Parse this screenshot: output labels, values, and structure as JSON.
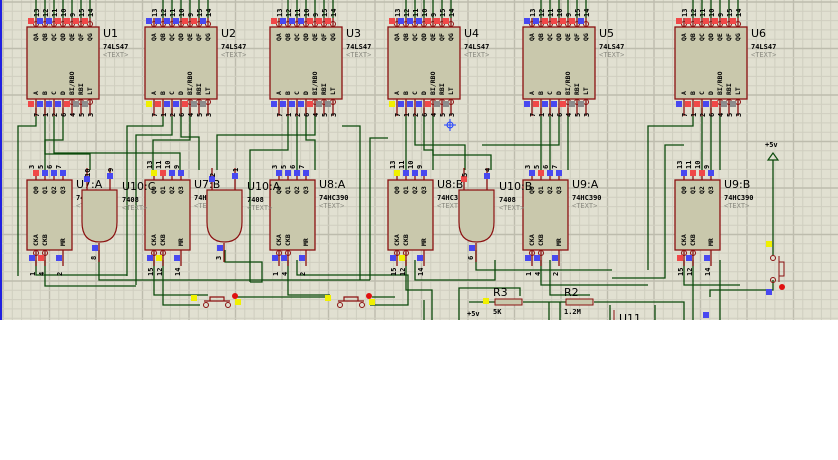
{
  "schematic": {
    "decoders": [
      {
        "ref": "U1",
        "part": "74LS47",
        "text": "<TEXT>",
        "top_states": [
          "r",
          "b",
          "b",
          "r",
          "r",
          "r",
          "r"
        ],
        "bottom_states": [
          "r",
          "b",
          "b",
          "b",
          "r",
          "g",
          "g"
        ]
      },
      {
        "ref": "U2",
        "part": "74LS47",
        "text": "<TEXT>",
        "top_states": [
          "b",
          "b",
          "b",
          "b",
          "r",
          "r",
          "b"
        ],
        "bottom_states": [
          "y",
          "r",
          "b",
          "b",
          "r",
          "g",
          "g"
        ]
      },
      {
        "ref": "U3",
        "part": "74LS47",
        "text": "<TEXT>",
        "top_states": [
          "r",
          "b",
          "b",
          "b",
          "r",
          "r",
          "r"
        ],
        "bottom_states": [
          "b",
          "b",
          "b",
          "b",
          "r",
          "g",
          "g"
        ]
      },
      {
        "ref": "U4",
        "part": "74LS47",
        "text": "<TEXT>",
        "top_states": [
          "r",
          "b",
          "b",
          "b",
          "r",
          "r",
          "r"
        ],
        "bottom_states": [
          "y",
          "b",
          "b",
          "b",
          "r",
          "g",
          "g"
        ]
      },
      {
        "ref": "U5",
        "part": "74LS47",
        "text": "<TEXT>",
        "top_states": [
          "b",
          "b",
          "r",
          "r",
          "r",
          "r",
          "b"
        ],
        "bottom_states": [
          "b",
          "r",
          "b",
          "b",
          "r",
          "g",
          "g"
        ]
      },
      {
        "ref": "U6",
        "part": "74LS47",
        "text": "<TEXT>",
        "top_states": [
          "r",
          "r",
          "r",
          "r",
          "r",
          "r",
          "r"
        ],
        "bottom_states": [
          "b",
          "r",
          "r",
          "b",
          "r",
          "g",
          "g"
        ]
      }
    ],
    "decoder_pins": {
      "top_numbers": [
        "13",
        "12",
        "11",
        "10",
        "9",
        "15",
        "14"
      ],
      "top_names": [
        "QA",
        "QB",
        "QC",
        "QD",
        "QE",
        "QF",
        "QG"
      ],
      "bottom_numbers": [
        "7",
        "1",
        "2",
        "6",
        "4",
        "5",
        "3"
      ],
      "bottom_names": [
        "A",
        "B",
        "C",
        "D",
        "BI/RBO",
        "RBI",
        "LT"
      ]
    },
    "counters": [
      {
        "ref": "U7:A",
        "part": "74HC390",
        "text": "<TEXT>",
        "top_numbers": [
          "3",
          "5",
          "6",
          "7"
        ],
        "bottom_numbers": [
          "1",
          "4",
          "2"
        ],
        "top_states": [
          "r",
          "b",
          "b",
          "b"
        ],
        "bottom_states": [
          "b",
          "r",
          "b"
        ]
      },
      {
        "ref": "U7:B",
        "part": "74HC390",
        "text": "<TEXT>",
        "top_numbers": [
          "13",
          "11",
          "10",
          "9"
        ],
        "bottom_numbers": [
          "15",
          "12",
          "14"
        ],
        "top_states": [
          "y",
          "r",
          "b",
          "b"
        ],
        "bottom_states": [
          "b",
          "y",
          "b"
        ]
      },
      {
        "ref": "U8:A",
        "part": "74HC390",
        "text": "<TEXT>",
        "top_numbers": [
          "3",
          "5",
          "6",
          "7"
        ],
        "bottom_numbers": [
          "1",
          "4",
          "2"
        ],
        "top_states": [
          "b",
          "b",
          "b",
          "b"
        ],
        "bottom_states": [
          "b",
          "b",
          "b"
        ]
      },
      {
        "ref": "U8:B",
        "part": "74HC390",
        "text": "<TEXT>",
        "top_numbers": [
          "13",
          "11",
          "10",
          "9"
        ],
        "bottom_numbers": [
          "15",
          "12",
          "14"
        ],
        "top_states": [
          "y",
          "b",
          "b",
          "b"
        ],
        "bottom_states": [
          "b",
          "y",
          "b"
        ]
      },
      {
        "ref": "U9:A",
        "part": "74HC390",
        "text": "<TEXT>",
        "top_numbers": [
          "3",
          "5",
          "6",
          "7"
        ],
        "bottom_numbers": [
          "1",
          "4",
          "2"
        ],
        "top_states": [
          "b",
          "r",
          "b",
          "b"
        ],
        "bottom_states": [
          "b",
          "b",
          "b"
        ]
      },
      {
        "ref": "U9:B",
        "part": "74HC390",
        "text": "<TEXT>",
        "top_numbers": [
          "13",
          "11",
          "10",
          "9"
        ],
        "bottom_numbers": [
          "15",
          "12",
          "14"
        ],
        "top_states": [
          "b",
          "r",
          "r",
          "b"
        ],
        "bottom_states": [
          "r",
          "b",
          "b"
        ]
      }
    ],
    "counter_pins": {
      "top_names": [
        "Q0",
        "Q1",
        "Q2",
        "Q3"
      ],
      "bottom_names": [
        "CKA",
        "CKB",
        "MR"
      ]
    },
    "gates": [
      {
        "ref": "U10:C",
        "part": "7408",
        "text": "<TEXT>",
        "in_numbers": [
          "10",
          "9"
        ],
        "out_number": "8",
        "in_states": [
          "b",
          "b"
        ],
        "out_state": "b"
      },
      {
        "ref": "U10:A",
        "part": "7408",
        "text": "<TEXT>",
        "in_numbers": [
          "2",
          "1"
        ],
        "out_number": "3",
        "in_states": [
          "b",
          "b"
        ],
        "out_state": "b"
      },
      {
        "ref": "U10:B",
        "part": "7408",
        "text": "<TEXT>",
        "in_numbers": [
          "5",
          "4"
        ],
        "out_number": "6",
        "in_states": [
          "r",
          "b"
        ],
        "out_state": "b"
      }
    ],
    "resistors": [
      {
        "ref": "R3",
        "value": "5K"
      },
      {
        "ref": "R2",
        "value": "1.2M"
      }
    ],
    "power_labels": {
      "top": "+5v",
      "bottom": "+5v"
    },
    "partial_ref": "U11",
    "state_colors": {
      "r": "#f04848",
      "b": "#4848f0",
      "y": "#f0f000",
      "g": "#8c8c8c"
    },
    "colors": {
      "wire": "#0b4a0b",
      "pin": "#8b1010",
      "body": "#c9c8ac",
      "grid_minor": "#cfcebf",
      "grid_major": "#bdbcad",
      "background": "#e1e0d1"
    }
  }
}
